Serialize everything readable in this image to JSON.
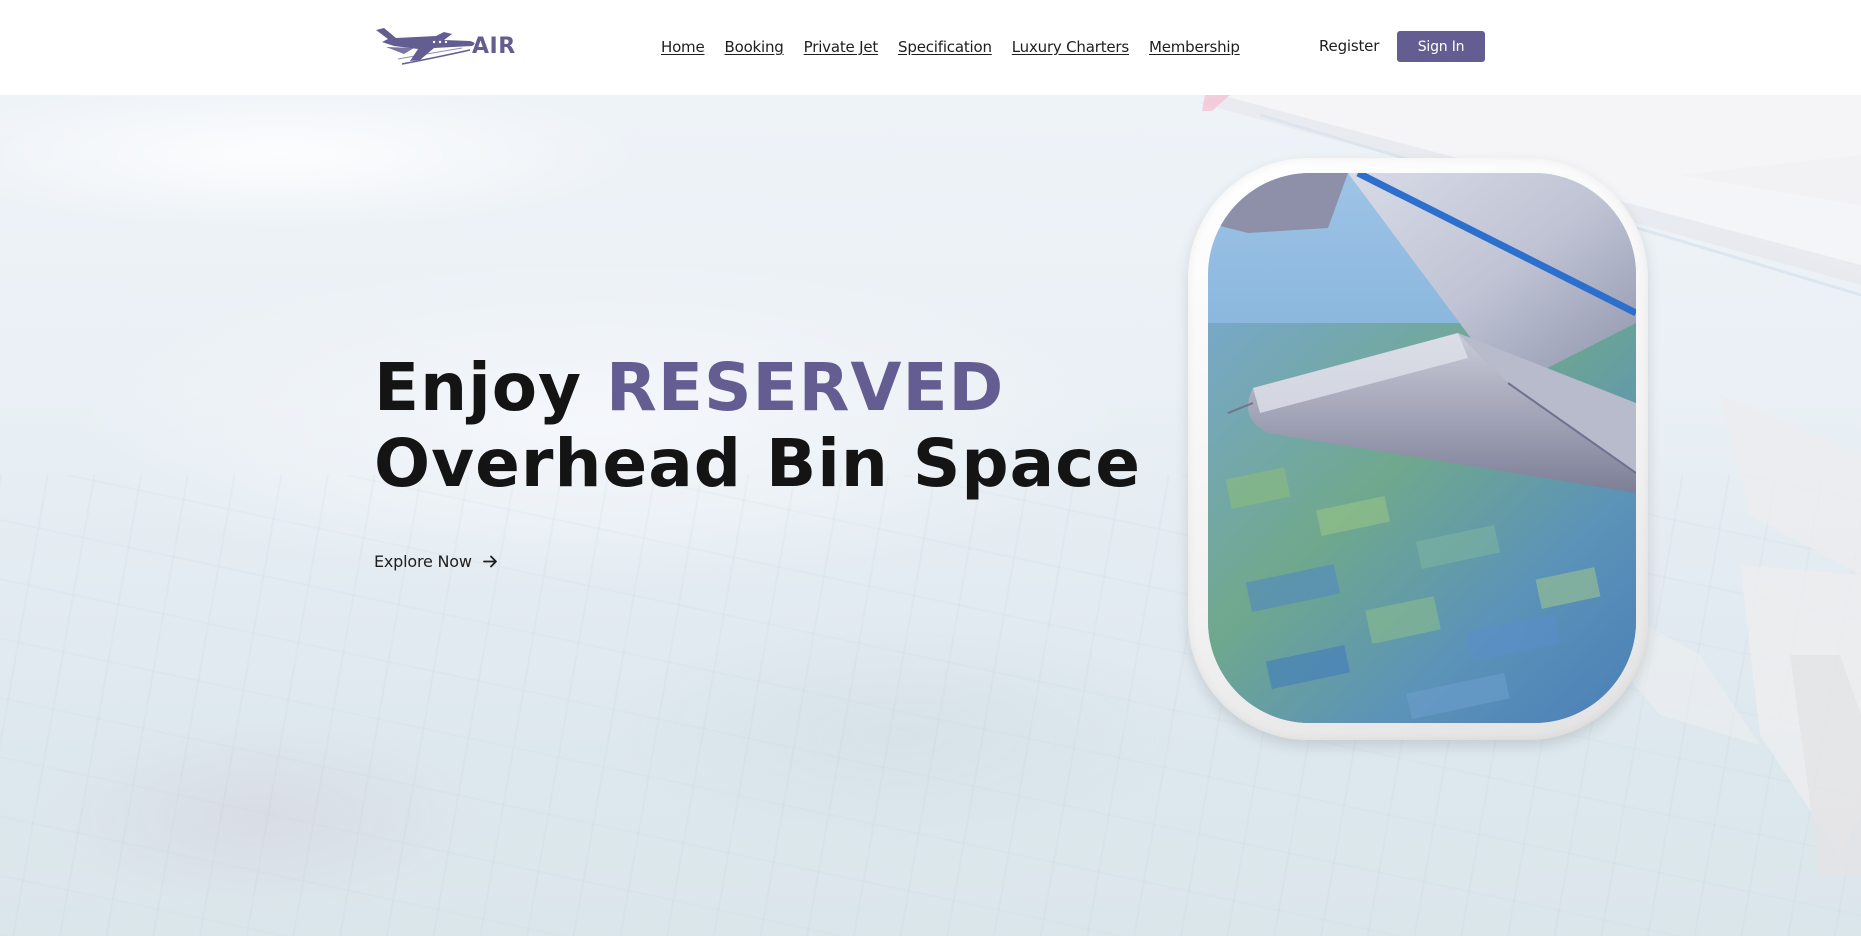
{
  "header": {
    "logo_text": "AIR",
    "nav": [
      "Home",
      "Booking",
      "Private Jet",
      "Specification",
      "Luxury Charters",
      "Membership"
    ],
    "register_label": "Register",
    "signin_label": "Sign In"
  },
  "hero": {
    "headline_prefix": "Enjoy ",
    "headline_accent": "RESERVED",
    "headline_line2": "Overhead Bin Space",
    "cta_label": "Explore Now"
  },
  "colors": {
    "brand": "#645d91",
    "text": "#141414",
    "background": "#ffffff"
  },
  "icons": {
    "logo": "airplane-logo-icon",
    "cta": "arrow-right-icon"
  }
}
